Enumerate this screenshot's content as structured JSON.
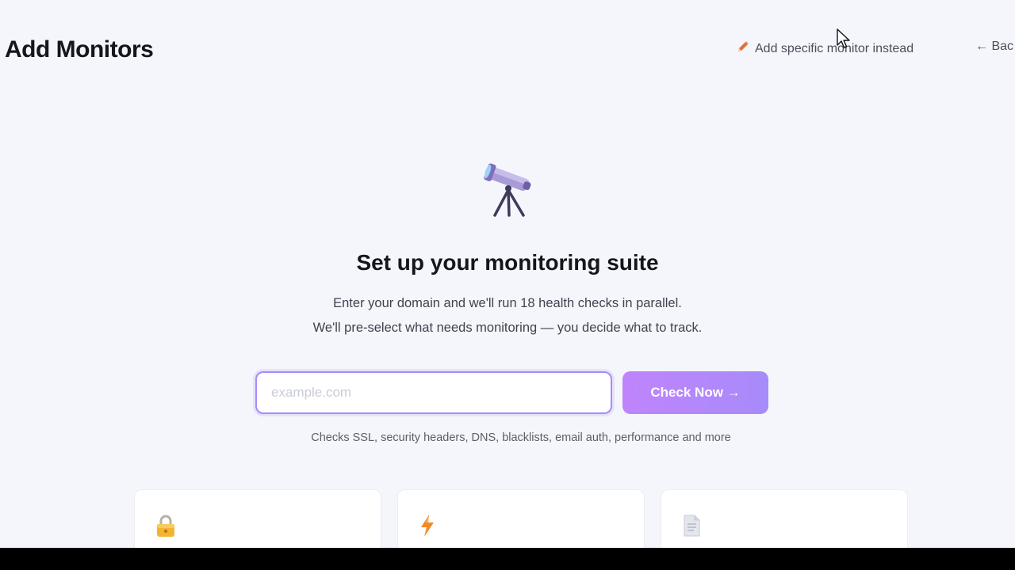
{
  "header": {
    "title": "Add Monitors",
    "specific_link": "Add specific monitor instead",
    "back_link": "← Bac"
  },
  "hero": {
    "title": "Set up your monitoring suite",
    "desc_line1": "Enter your domain and we'll run 18 health checks in parallel.",
    "desc_line2": "We'll pre-select what needs monitoring — you decide what to track."
  },
  "form": {
    "input_value": "",
    "input_placeholder": "example.com",
    "button_label": "Check Now →"
  },
  "note": "Checks SSL, security headers, DNS, blacklists, email auth, performance and more",
  "cards": [
    {
      "icon": "lock-icon"
    },
    {
      "icon": "lightning-icon"
    },
    {
      "icon": "document-icon"
    }
  ],
  "colors": {
    "accent": "#a78bfa",
    "accent_start": "#c084fc",
    "background": "#f4f6fb",
    "pencil": "#e0703a"
  }
}
